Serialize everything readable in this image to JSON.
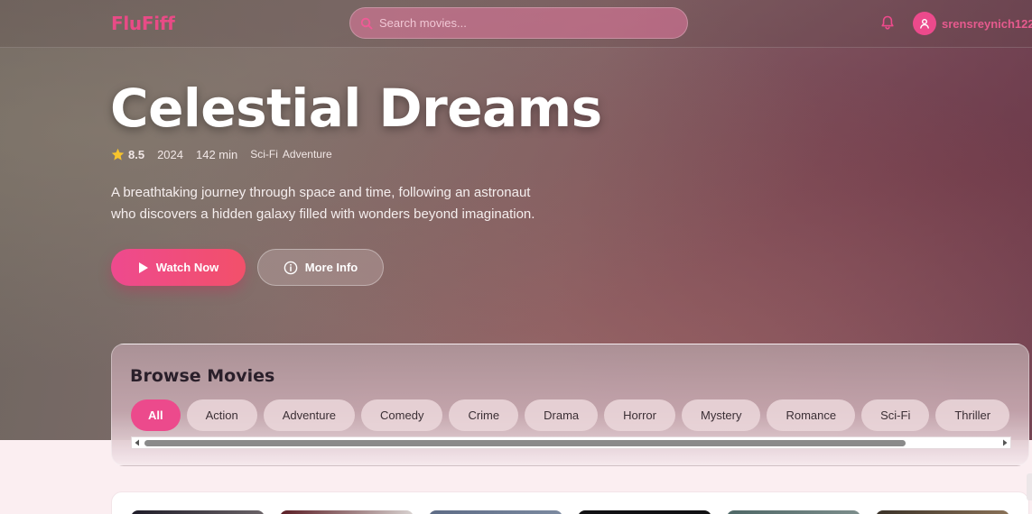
{
  "app": {
    "logo": "FluFiff"
  },
  "search": {
    "placeholder": "Search movies..."
  },
  "user": {
    "name": "srensreynich122"
  },
  "hero": {
    "title": "Celestial Dreams",
    "rating": "8.5",
    "year": "2024",
    "runtime": "142 min",
    "genres": [
      "Sci-Fi",
      "Adventure"
    ],
    "description": "A breathtaking journey through space and time, following an astronaut who discovers a hidden galaxy filled with wonders beyond imagination.",
    "watch_label": "Watch Now",
    "info_label": "More Info"
  },
  "browse": {
    "title": "Browse Movies",
    "genres": [
      "All",
      "Action",
      "Adventure",
      "Comedy",
      "Crime",
      "Drama",
      "Horror",
      "Mystery",
      "Romance",
      "Sci-Fi",
      "Thriller"
    ],
    "active": "All"
  },
  "colors": {
    "accent": "#ec4a8c",
    "heading_dark": "#2a1f2a"
  }
}
